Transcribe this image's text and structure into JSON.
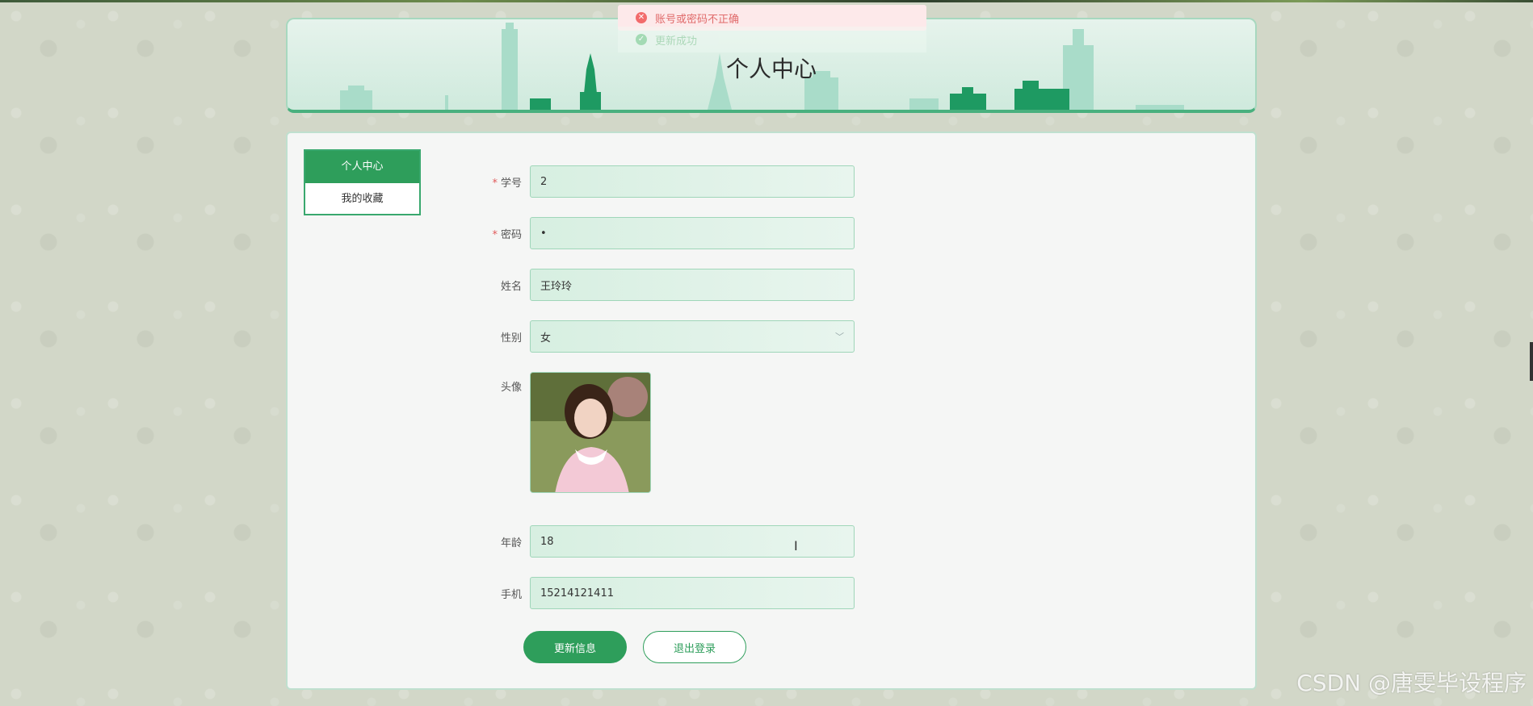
{
  "header": {
    "title": "个人中心"
  },
  "toasts": {
    "error": "账号或密码不正确",
    "success": "更新成功"
  },
  "sidebar": {
    "items": [
      {
        "label": "个人中心",
        "active": true
      },
      {
        "label": "我的收藏",
        "active": false
      }
    ]
  },
  "form": {
    "student_id": {
      "label": "学号",
      "value": "2",
      "required": true
    },
    "password": {
      "label": "密码",
      "value": "•",
      "required": true
    },
    "name": {
      "label": "姓名",
      "value": "王玲玲"
    },
    "gender": {
      "label": "性别",
      "value": "女"
    },
    "avatar": {
      "label": "头像"
    },
    "age": {
      "label": "年龄",
      "value": "18"
    },
    "phone": {
      "label": "手机",
      "value": "15214121411"
    }
  },
  "buttons": {
    "update": "更新信息",
    "logout": "退出登录"
  },
  "watermark": "CSDN @唐雯毕设程序",
  "colors": {
    "primary": "#2e9e5b",
    "error": "#f26b6b",
    "input_bg": "#d7efe1"
  }
}
